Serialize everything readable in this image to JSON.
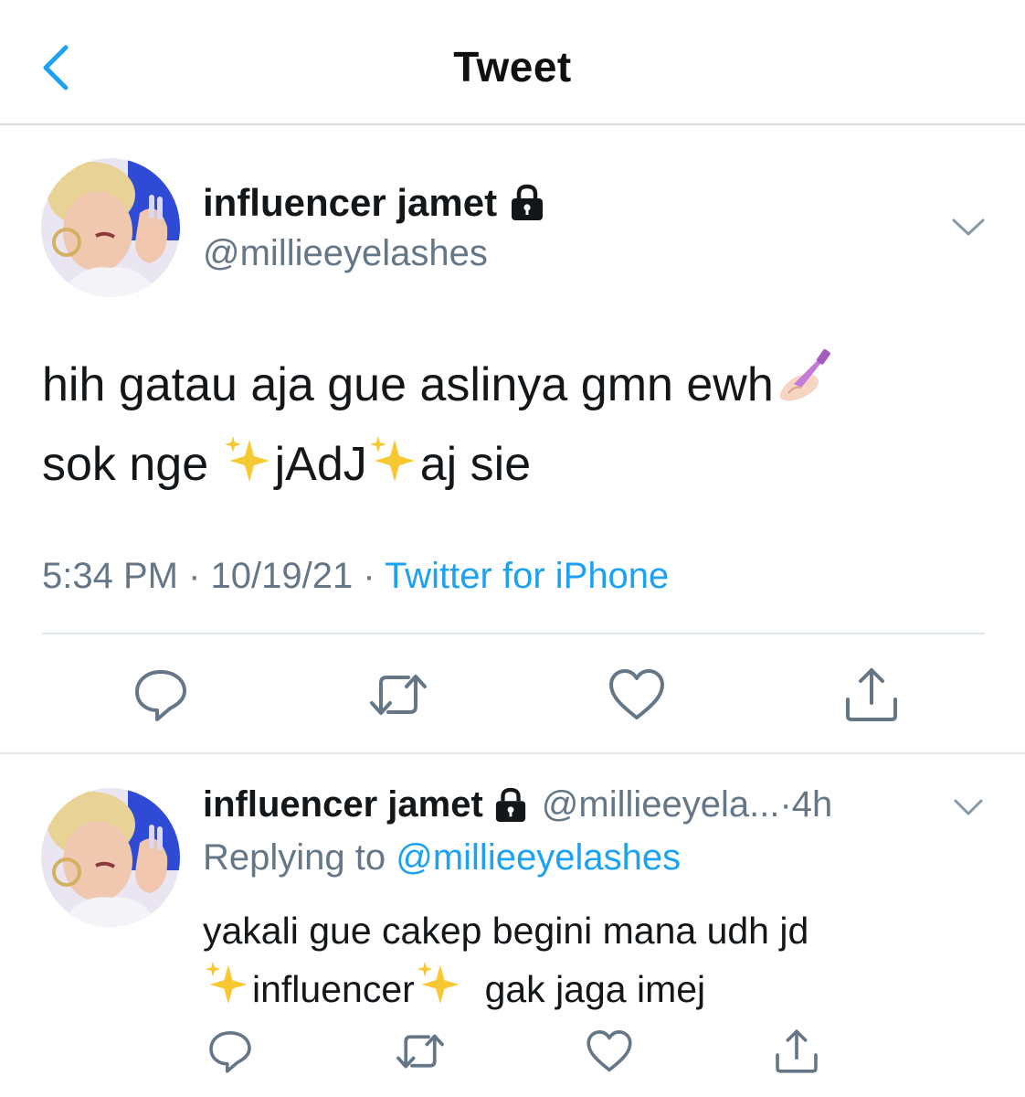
{
  "nav": {
    "title": "Tweet",
    "back_icon": "chevron-left-icon"
  },
  "colors": {
    "accent": "#1da1f2",
    "text": "#14171a",
    "muted": "#657786",
    "divider": "#e1e8ed"
  },
  "tweet": {
    "display_name": "influencer jamet",
    "handle": "@millieeyelashes",
    "text_line1": "hih gatau aja gue aslinya gmn ewh",
    "text_line2_a": "sok nge ",
    "text_line2_b": "jAdJ",
    "text_line2_c": "aj sie",
    "emojis": [
      "nail-polish-emoji",
      "sparkles-emoji"
    ],
    "time": "5:34 PM",
    "date": "10/19/21",
    "separator": " · ",
    "source": "Twitter for iPhone",
    "actions": [
      "reply-icon",
      "retweet-icon",
      "like-icon",
      "share-icon"
    ]
  },
  "reply": {
    "display_name": "influencer jamet",
    "handle_truncated": "@millieeyela...",
    "age": "4h",
    "age_separator": " · ",
    "replying_prefix": "Replying to ",
    "replying_to": "@millieeyelashes",
    "text_line1": "yakali gue cakep begini mana udh jd",
    "text_word": "influencer",
    "text_end": "gak jaga imej"
  }
}
